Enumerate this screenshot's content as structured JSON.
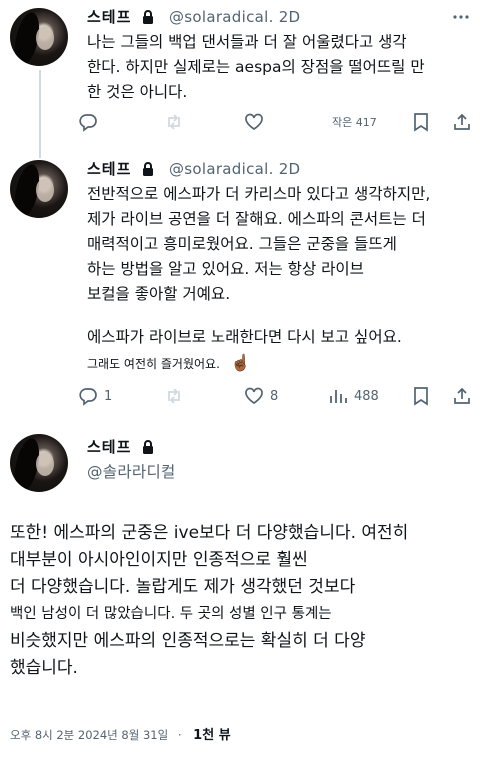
{
  "tweets": [
    {
      "name": "스테프",
      "handle": "@solaradical. 2D",
      "lines": [
        "나는 그들의 백업 댄서들과 더 잘 어울렸다고 생각",
        "한다. 하지만 실제로는 aespa의 장점을 떨어뜨릴 만",
        "한 것은 아니다."
      ],
      "stats": {
        "views_label": "작은 417"
      }
    },
    {
      "name": "스테프",
      "handle": "@solaradical. 2D",
      "lines": [
        "전반적으로 에스파가 더 카리스마 있다고 생각하지만,",
        "제가 라이브 공연을 더 잘해요. 에스파의 콘서트는 더",
        "매력적이고 흥미로웠어요. 그들은 군중을 들뜨게",
        "하는 방법을 알고 있어요. 저는 항상 라이브",
        "보컬을 좋아할 거예요."
      ],
      "line2": "에스파가 라이브로 노래한다면 다시 보고 싶어요.",
      "line3": "그래도 여전히 즐거웠어요.",
      "emoji": "☝🏾",
      "stats": {
        "replies": "1",
        "likes": "8",
        "views": "488"
      }
    },
    {
      "name": "스테프",
      "handle": "@솔라라디컬",
      "lines": [
        "또한! 에스파의 군중은 ive보다 더 다양했습니다. 여전히",
        "대부분이 아시아인이지만 인종적으로 훨씬",
        "더 다양했습니다. 놀랍게도 제가 생각했던 것보다",
        "백인 남성이 더 많았습니다. 두 곳의 성별 인구 통계는",
        "비슷했지만 에스파의 인종적으로는 확실히 더 다양",
        "했습니다."
      ],
      "timestamp": "오후 8시 2분 2024년 8월 31일",
      "views": "1천 뷰"
    }
  ],
  "icons": [
    "reply-icon",
    "retweet-icon",
    "like-icon",
    "views-icon",
    "bookmark-icon",
    "share-icon",
    "lock-icon",
    "more-icon"
  ],
  "colors": {
    "text": "#0f1419",
    "secondary": "#536471",
    "divider": "#cfd9de"
  }
}
